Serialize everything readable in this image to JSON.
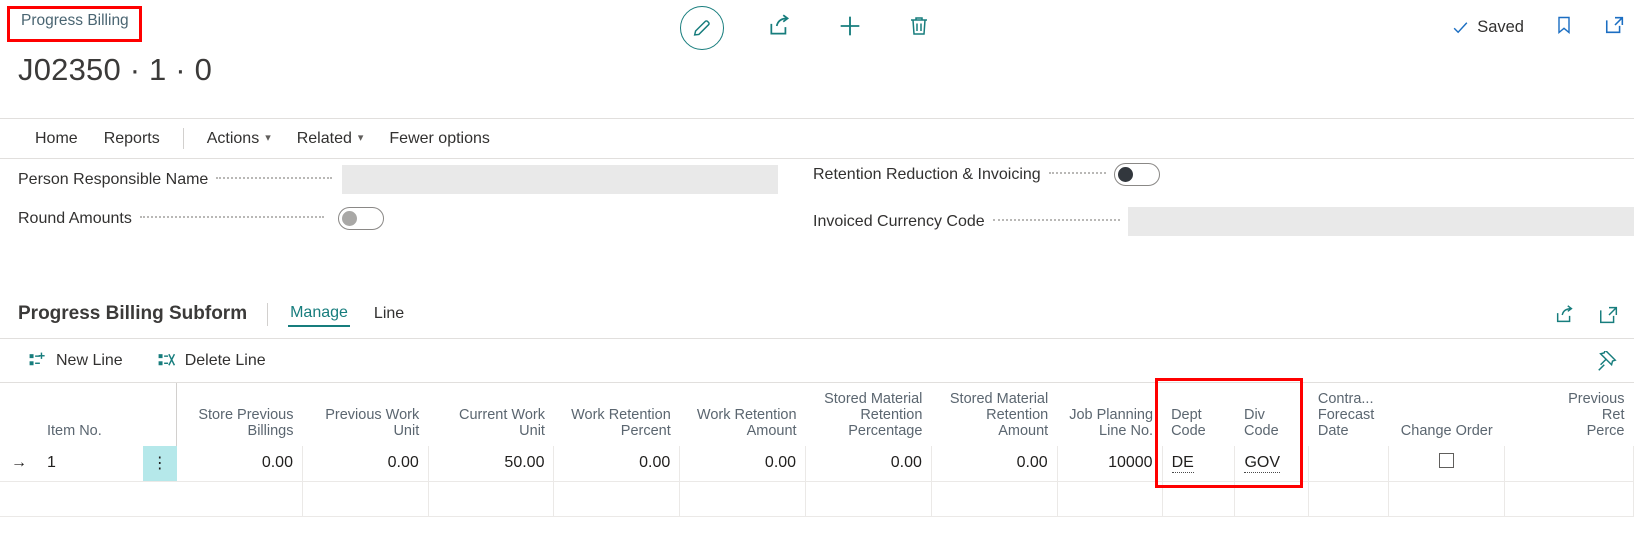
{
  "breadcrumb": "Progress Billing",
  "title": "J02350 · 1 · 0",
  "toolbar": {
    "edit_icon": "pencil-icon",
    "share_icon": "share-icon",
    "new_icon": "plus-icon",
    "delete_icon": "trash-icon",
    "saved_label": "Saved",
    "bookmark_icon": "bookmark-icon",
    "open_new_icon": "open-in-new-window-icon"
  },
  "menu": {
    "items": [
      {
        "label": "Home",
        "chevron": false
      },
      {
        "label": "Reports",
        "chevron": false
      },
      {
        "label": "Actions",
        "chevron": true
      },
      {
        "label": "Related",
        "chevron": true
      },
      {
        "label": "Fewer options",
        "chevron": false
      }
    ]
  },
  "fields": {
    "person_responsible_name": {
      "label": "Person Responsible Name",
      "value": ""
    },
    "round_amounts": {
      "label": "Round Amounts",
      "value": "off"
    },
    "retention_reduction_invoicing": {
      "label": "Retention Reduction & Invoicing",
      "value": "off"
    },
    "invoiced_currency_code": {
      "label": "Invoiced Currency Code",
      "value": ""
    }
  },
  "subform": {
    "title": "Progress Billing Subform",
    "tabs": [
      {
        "label": "Manage",
        "active": true
      },
      {
        "label": "Line",
        "active": false
      }
    ],
    "share_icon": "share-icon",
    "expand_icon": "expand-icon",
    "actions": [
      {
        "label": "New Line",
        "icon": "new-line-icon"
      },
      {
        "label": "Delete Line",
        "icon": "delete-line-icon"
      }
    ],
    "pin_icon": "pin-icon"
  },
  "grid": {
    "columns": [
      {
        "key": "item_no",
        "header": "Item No.",
        "align": "lft"
      },
      {
        "key": "store_prev_billings",
        "header": "Store Previous\nBillings",
        "align": "num"
      },
      {
        "key": "prev_work_unit",
        "header": "Previous Work\nUnit",
        "align": "num"
      },
      {
        "key": "curr_work_unit",
        "header": "Current Work\nUnit",
        "align": "num"
      },
      {
        "key": "work_ret_percent",
        "header": "Work Retention\nPercent",
        "align": "num"
      },
      {
        "key": "work_ret_amount",
        "header": "Work Retention\nAmount",
        "align": "num"
      },
      {
        "key": "stored_ret_pct",
        "header": "Stored Material\nRetention\nPercentage",
        "align": "num"
      },
      {
        "key": "stored_ret_amt",
        "header": "Stored Material\nRetention\nAmount",
        "align": "num"
      },
      {
        "key": "job_plan_line_no",
        "header": "Job Planning\nLine No.",
        "align": "num"
      },
      {
        "key": "dept_code",
        "header": "Dept\nCode",
        "align": "lft"
      },
      {
        "key": "div_code",
        "header": "Div\nCode",
        "align": "lft"
      },
      {
        "key": "contract_forecast",
        "header": "Contra...\nForecast\nDate",
        "align": "lft"
      },
      {
        "key": "change_order",
        "header": "Change Order",
        "align": "ctr"
      },
      {
        "key": "prev_ret_percent",
        "header": "Previous\nRet\nPerce",
        "align": "num"
      }
    ],
    "rows": [
      {
        "row_indicator": "→",
        "ellipsis": "⋮",
        "item_no": "1",
        "store_prev_billings": "0.00",
        "prev_work_unit": "0.00",
        "curr_work_unit": "50.00",
        "work_ret_percent": "0.00",
        "work_ret_amount": "0.00",
        "stored_ret_pct": "0.00",
        "stored_ret_amt": "0.00",
        "job_plan_line_no": "10000",
        "dept_code": "DE",
        "div_code": "GOV",
        "contract_forecast": "",
        "change_order": "unchecked",
        "prev_ret_percent": ""
      }
    ]
  },
  "highlights": [
    {
      "name": "breadcrumb-highlight",
      "color": "#ff0000"
    },
    {
      "name": "dept-div-code-highlight",
      "color": "#ff0000"
    }
  ]
}
